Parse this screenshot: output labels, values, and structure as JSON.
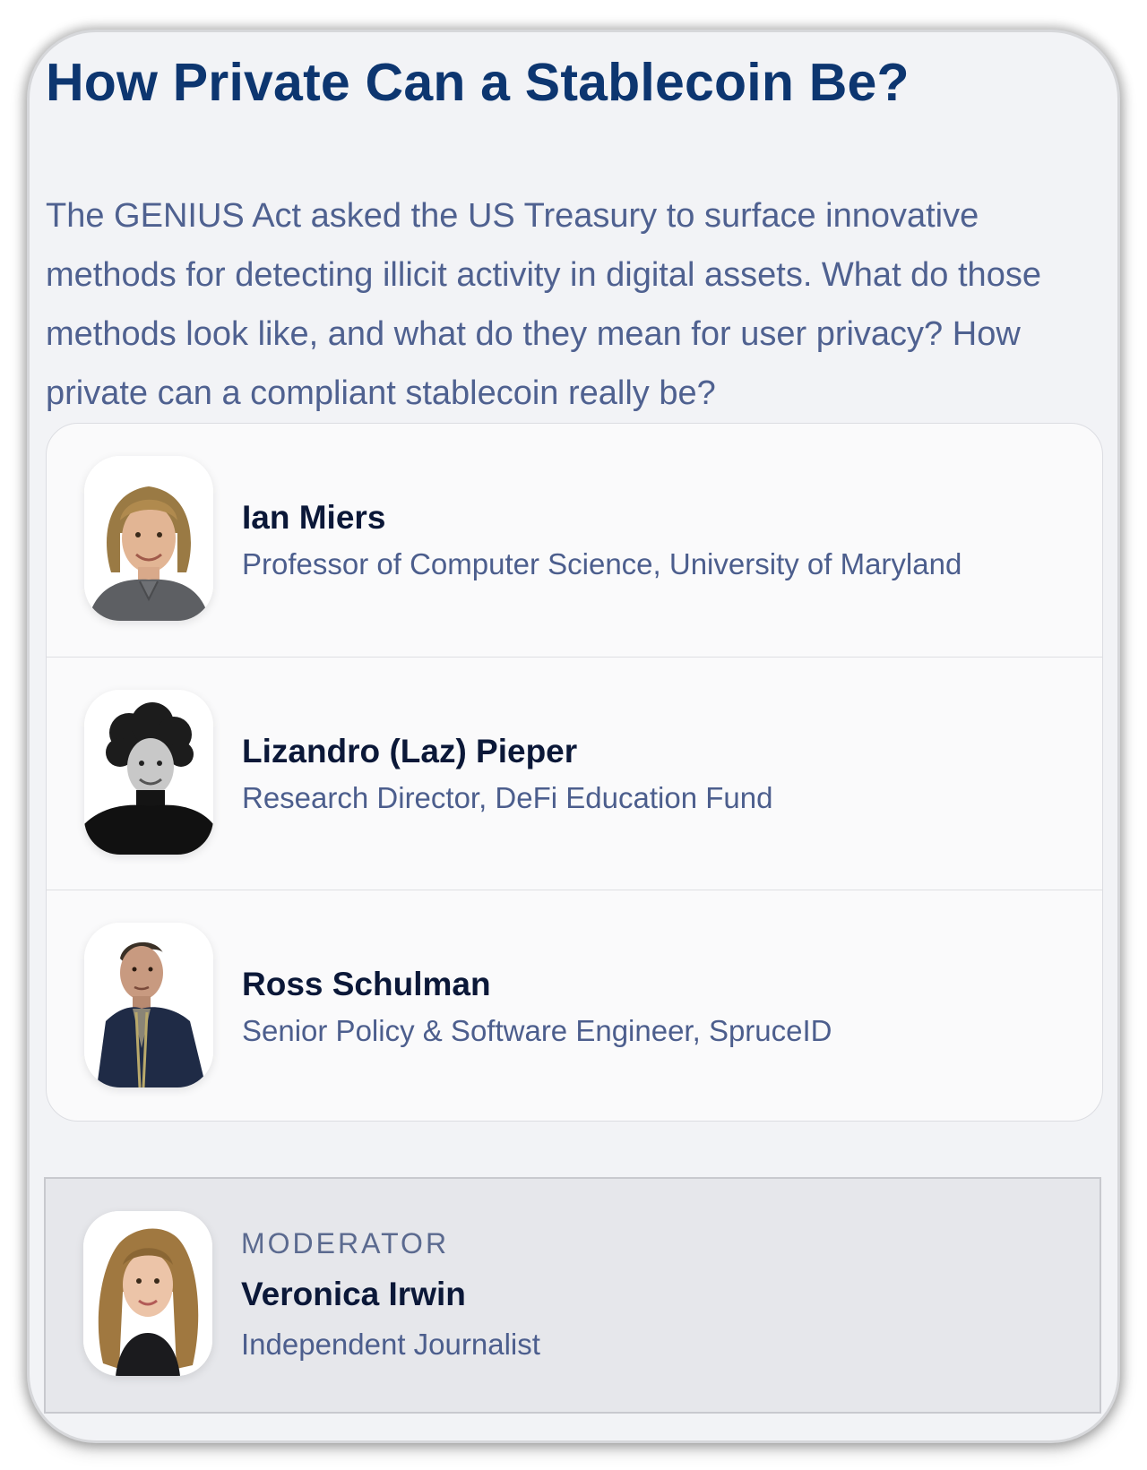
{
  "session": {
    "title": "How Private Can a Stablecoin Be?",
    "description": "The GENIUS Act asked the US Treasury to surface innovative methods for detecting illicit activity in digital assets. What do those methods look like, and what do they mean for user privacy? How private can a compliant stablecoin really be?"
  },
  "panelists": [
    {
      "name": "Ian Miers",
      "role": "Professor of Computer Science, University of Maryland"
    },
    {
      "name": "Lizandro (Laz) Pieper",
      "role": "Research Director, DeFi Education Fund"
    },
    {
      "name": "Ross Schulman",
      "role": "Senior Policy & Software Engineer, SpruceID"
    }
  ],
  "moderator": {
    "label": "MODERATOR",
    "name": "Veronica Irwin",
    "role": "Independent Journalist"
  },
  "colors": {
    "title": "#0d3670",
    "body_text": "#4f6190",
    "name_text": "#0b1838",
    "card_background": "#f2f3f6",
    "moderator_background": "#e6e7eb"
  }
}
